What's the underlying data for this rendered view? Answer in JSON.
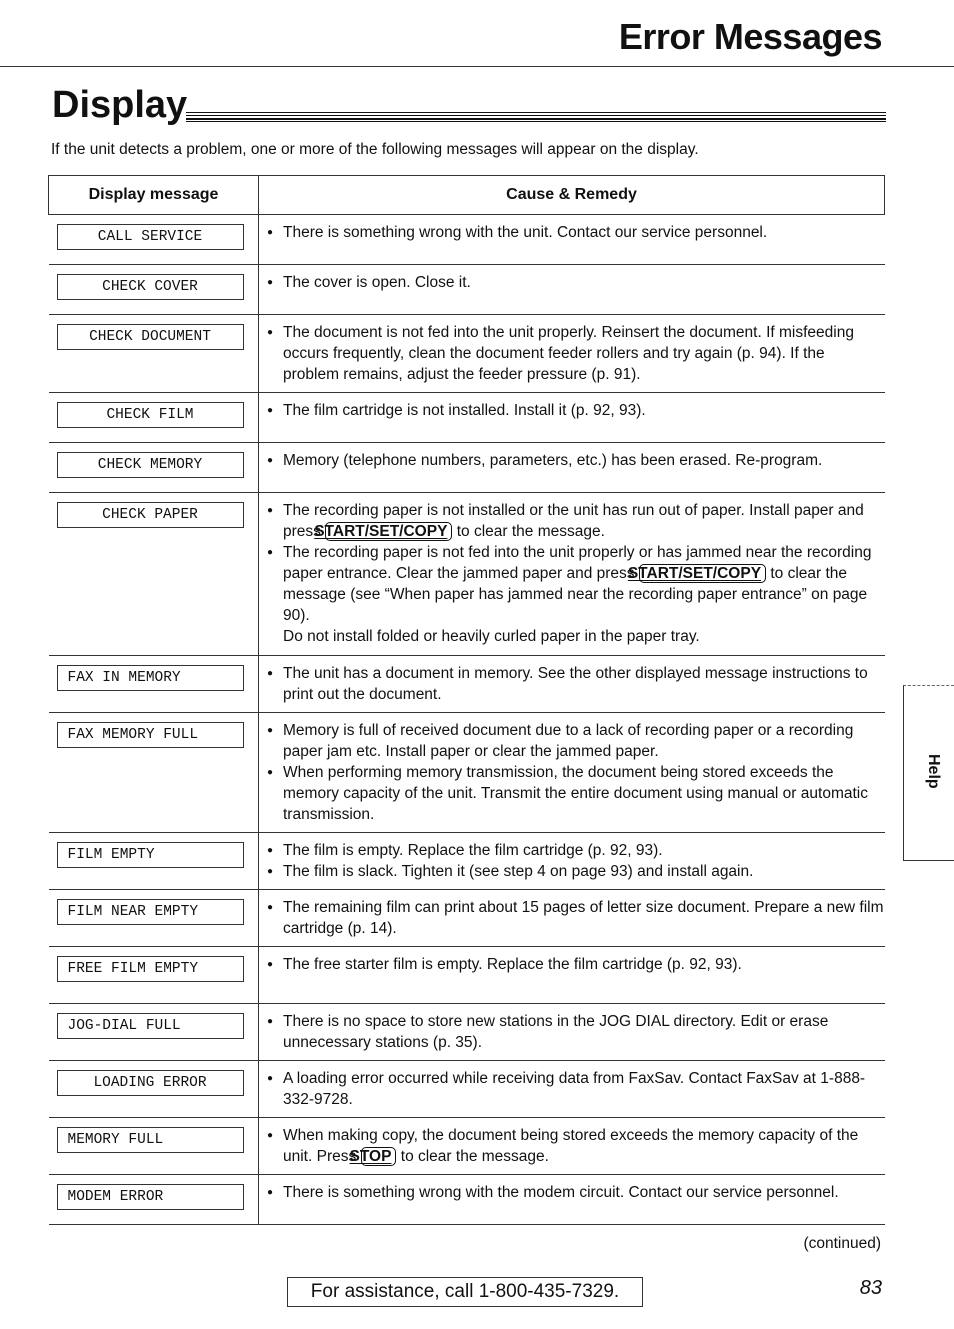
{
  "header": {
    "title": "Error Messages"
  },
  "section": {
    "title": "Display",
    "intro": "If the unit detects a problem, one or more of the following messages will appear on the display."
  },
  "table": {
    "columns": [
      "Display message",
      "Cause & Remedy"
    ],
    "rows": [
      {
        "message": "CALL SERVICE",
        "remedy": [
          "There is something wrong with the unit. Contact our service personnel."
        ]
      },
      {
        "message": "CHECK COVER",
        "remedy": [
          "The cover is open. Close it."
        ]
      },
      {
        "message": "CHECK DOCUMENT",
        "remedy": [
          "The document is not fed into the unit properly. Reinsert the document. If misfeeding occurs frequently, clean the document feeder rollers and try again (p. 94). If the problem remains, adjust the feeder pressure (p. 91)."
        ]
      },
      {
        "message": "CHECK FILM",
        "remedy": [
          "The film cartridge is not installed. Install it (p. 92, 93)."
        ]
      },
      {
        "message": "CHECK MEMORY",
        "remedy": [
          "Memory (telephone numbers, parameters, etc.) has been erased. Re-program."
        ]
      },
      {
        "message": "CHECK PAPER",
        "remedy_rich": [
          {
            "pre": "The recording paper is not installed or the unit has run out of paper. Install paper and press ",
            "key": "START/SET/COPY",
            "post": " to clear the message."
          },
          {
            "pre": "The recording paper is not fed into the unit properly or has jammed near the recording paper entrance. Clear the jammed paper and press ",
            "key": "START/SET/COPY",
            "post": " to clear the message (see “When paper has jammed near the recording paper entrance” on page 90)."
          }
        ],
        "note": "Do not install folded or heavily curled paper in the paper tray."
      },
      {
        "message": "FAX IN MEMORY",
        "remedy": [
          "The unit has a document in memory. See the other displayed message instructions to print out the document."
        ]
      },
      {
        "message": "FAX MEMORY FULL",
        "remedy": [
          "Memory is full of received document due to a lack of recording paper or a recording paper jam etc. Install paper or clear the jammed paper.",
          "When performing memory transmission, the document being stored exceeds the memory capacity of the unit. Transmit the entire document using manual or automatic transmission."
        ]
      },
      {
        "message": "FILM EMPTY",
        "remedy": [
          "The film is empty. Replace the film cartridge (p. 92, 93).",
          "The film is slack. Tighten it (see step 4 on page 93) and install again."
        ]
      },
      {
        "message": "FILM NEAR EMPTY",
        "remedy": [
          "The remaining film can print about 15 pages of letter size document. Prepare a new film cartridge (p. 14)."
        ]
      },
      {
        "message": "FREE FILM EMPTY",
        "remedy": [
          "The free starter film is empty. Replace the film cartridge (p. 92, 93)."
        ]
      },
      {
        "message": "JOG-DIAL FULL",
        "remedy": [
          "There is no space to store new stations in the JOG DIAL directory. Edit or erase unnecessary stations (p. 35)."
        ]
      },
      {
        "message": "LOADING ERROR",
        "remedy": [
          "A loading error occurred while receiving data from FaxSav. Contact FaxSav at 1-888-332-9728."
        ]
      },
      {
        "message": "MEMORY FULL",
        "remedy_rich": [
          {
            "pre": "When making copy, the document being stored exceeds the memory capacity of the unit. Press ",
            "key": "STOP",
            "post": " to clear the message."
          }
        ]
      },
      {
        "message": "MODEM ERROR",
        "remedy": [
          "There is something wrong with the modem circuit. Contact our service personnel."
        ]
      }
    ]
  },
  "footer": {
    "continued": "(continued)",
    "assistance": "For assistance, call 1-800-435-7329.",
    "page_number": "83"
  },
  "side_tab": {
    "label": "Help"
  }
}
